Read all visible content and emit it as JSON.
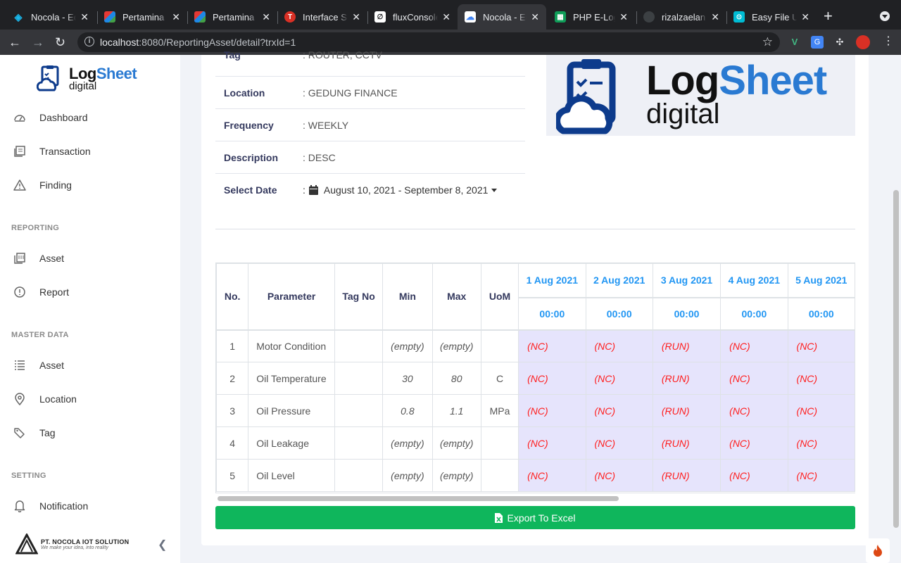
{
  "browser": {
    "tabs": [
      {
        "label": "Nocola - Ec",
        "favicon": "nocola-icon",
        "color": "#1ab7ea"
      },
      {
        "label": "Pertamina",
        "favicon": "pertamina-icon",
        "color": "#e53935"
      },
      {
        "label": "Pertamina",
        "favicon": "pertamina-icon",
        "color": "#e53935"
      },
      {
        "label": "Interface S",
        "favicon": "interface-icon",
        "color": "#d93025"
      },
      {
        "label": "fluxConsole",
        "favicon": "flux-icon",
        "color": "#ffffff"
      },
      {
        "label": "Nocola - Ec",
        "favicon": "nocola-cloud-icon",
        "color": "#4285f4"
      },
      {
        "label": "PHP E-Log",
        "favicon": "sheets-icon",
        "color": "#0f9d58"
      },
      {
        "label": "rizalzaelan",
        "favicon": "github-icon",
        "color": "#24292e"
      },
      {
        "label": "Easy File U",
        "favicon": "easyfile-icon",
        "color": "#00bcd4"
      }
    ],
    "url_host": "localhost",
    "url_path": ":8080/ReportingAsset/detail?trxId=1"
  },
  "sidebar": {
    "brand_line1": "LogSheet",
    "brand_line2": "digital",
    "items": [
      {
        "label": "Dashboard",
        "icon": "dashboard-icon"
      },
      {
        "label": "Transaction",
        "icon": "transaction-icon"
      },
      {
        "label": "Finding",
        "icon": "warning-icon"
      }
    ],
    "reporting_title": "REPORTING",
    "reporting_items": [
      {
        "label": "Asset",
        "icon": "asset-report-icon"
      },
      {
        "label": "Report",
        "icon": "report-icon"
      }
    ],
    "master_title": "MASTER DATA",
    "master_items": [
      {
        "label": "Asset",
        "icon": "list-icon"
      },
      {
        "label": "Location",
        "icon": "location-pin-icon"
      },
      {
        "label": "Tag",
        "icon": "tag-icon"
      }
    ],
    "setting_title": "SETTING",
    "setting_items": [
      {
        "label": "Notification",
        "icon": "bell-icon"
      }
    ],
    "company_name": "PT. NOCOLA IOT SOLUTION",
    "company_slogan": "We make your idea, into reality"
  },
  "detail": {
    "rows": [
      {
        "key": "Tag",
        "value": ": ROUTER, CCTV"
      },
      {
        "key": "Location",
        "value": ": GEDUNG FINANCE"
      },
      {
        "key": "Frequency",
        "value": ": WEEKLY"
      },
      {
        "key": "Description",
        "value": ": DESC"
      }
    ],
    "date_key": "Select Date",
    "date_colon": ":",
    "date_range": "August 10, 2021 - September 8, 2021"
  },
  "logo": {
    "line1_a": "Log",
    "line1_b": "Sheet",
    "line2": "digital"
  },
  "table": {
    "headers": {
      "no": "No.",
      "parameter": "Parameter",
      "tag_no": "Tag No",
      "min": "Min",
      "max": "Max",
      "uom": "UoM"
    },
    "dates": [
      "1 Aug 2021",
      "2 Aug 2021",
      "3 Aug 2021",
      "4 Aug 2021",
      "5 Aug 2021"
    ],
    "times": [
      "00:00",
      "00:00",
      "00:00",
      "00:00",
      "00:00"
    ],
    "rows": [
      {
        "no": "1",
        "parameter": "Motor Condition",
        "tag_no": "",
        "min": "(empty)",
        "max": "(empty)",
        "uom": "",
        "values": [
          "(NC)",
          "(NC)",
          "(RUN)",
          "(NC)",
          "(NC)"
        ]
      },
      {
        "no": "2",
        "parameter": "Oil Temperature",
        "tag_no": "",
        "min": "30",
        "max": "80",
        "uom": "C",
        "values": [
          "(NC)",
          "(NC)",
          "(RUN)",
          "(NC)",
          "(NC)"
        ]
      },
      {
        "no": "3",
        "parameter": "Oil Pressure",
        "tag_no": "",
        "min": "0.8",
        "max": "1.1",
        "uom": "MPa",
        "values": [
          "(NC)",
          "(NC)",
          "(RUN)",
          "(NC)",
          "(NC)"
        ]
      },
      {
        "no": "4",
        "parameter": "Oil Leakage",
        "tag_no": "",
        "min": "(empty)",
        "max": "(empty)",
        "uom": "",
        "values": [
          "(NC)",
          "(NC)",
          "(RUN)",
          "(NC)",
          "(NC)"
        ]
      },
      {
        "no": "5",
        "parameter": "Oil Level",
        "tag_no": "",
        "min": "(empty)",
        "max": "(empty)",
        "uom": "",
        "values": [
          "(NC)",
          "(NC)",
          "(RUN)",
          "(NC)",
          "(NC)"
        ]
      }
    ]
  },
  "export_label": "Export To Excel",
  "colors": {
    "accent_blue": "#2196f3",
    "brand_navy": "#0d3b8c",
    "export_green": "#0fb65c",
    "status_red": "#ff1e1e",
    "status_bg": "#e6e4fc"
  }
}
